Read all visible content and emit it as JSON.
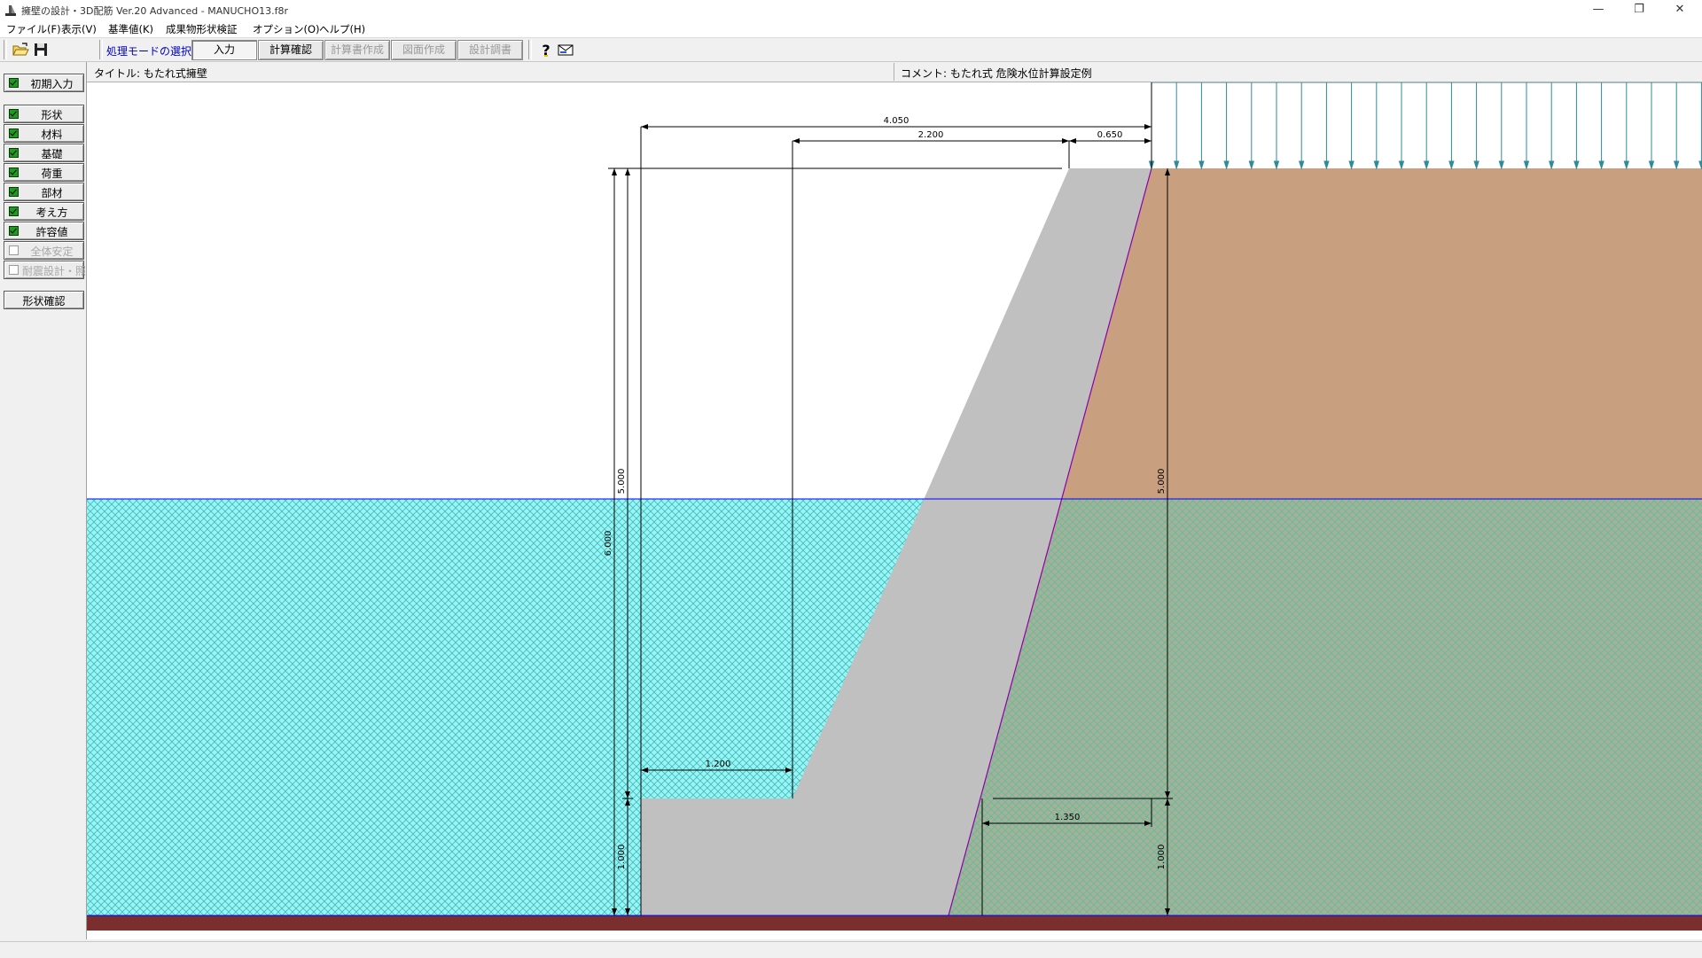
{
  "window": {
    "title": "擁壁の設計・3D配筋 Ver.20 Advanced  - MANUCHO13.f8r",
    "minimize": "—",
    "restore": "❐",
    "close": "✕"
  },
  "menu": [
    "ファイル(F)",
    "表示(V)",
    "基準値(K)",
    "成果物形状検証",
    "オプション(O)",
    "ヘルプ(H)"
  ],
  "toolbar": {
    "mode_label": "処理モードの選択",
    "modes": [
      {
        "label": "入力",
        "state": "active"
      },
      {
        "label": "計算確認",
        "state": "enabled"
      },
      {
        "label": "計算書作成",
        "state": "disabled"
      },
      {
        "label": "図面作成",
        "state": "disabled"
      },
      {
        "label": "設計調書",
        "state": "disabled"
      }
    ],
    "icons": [
      "open-folder-icon",
      "save-icon",
      "help-icon",
      "mail-icon"
    ]
  },
  "left_panel": {
    "initial_input": {
      "label": "初期入力",
      "checked": true
    },
    "items": [
      {
        "label": "形状",
        "checked": true,
        "enabled": true
      },
      {
        "label": "材料",
        "checked": true,
        "enabled": true
      },
      {
        "label": "基礎",
        "checked": true,
        "enabled": true
      },
      {
        "label": "荷重",
        "checked": true,
        "enabled": true
      },
      {
        "label": "部材",
        "checked": true,
        "enabled": true
      },
      {
        "label": "考え方",
        "checked": true,
        "enabled": true
      },
      {
        "label": "許容値",
        "checked": true,
        "enabled": true
      },
      {
        "label": "全体安定",
        "checked": false,
        "enabled": false
      },
      {
        "label": "耐震設計・照",
        "checked": false,
        "enabled": false
      }
    ],
    "shape_check": "形状確認"
  },
  "header": {
    "title": "タイトル: もたれ式擁壁",
    "comment": "コメント: もたれ式 危険水位計算設定例"
  },
  "drawing": {
    "colors": {
      "concrete": "#c0c0c0",
      "soil": "#c8a080",
      "water": "#9ff2f2",
      "water_hatch": "#33c0c0",
      "ground": "#7a2e2e",
      "load_arrows": "#2e8b9a",
      "water_line": "#0000ff",
      "slope_line": "#8b00aa"
    },
    "dimensions": {
      "top_total": "4.050",
      "top_mid": "2.200",
      "top_right": "0.650",
      "left_outer": "6.000",
      "left_inner_upper": "5.000",
      "left_inner_lower": "1.000",
      "right_upper": "5.000",
      "right_lower": "1.000",
      "toe_width": "1.200",
      "heel_width": "1.350"
    }
  }
}
